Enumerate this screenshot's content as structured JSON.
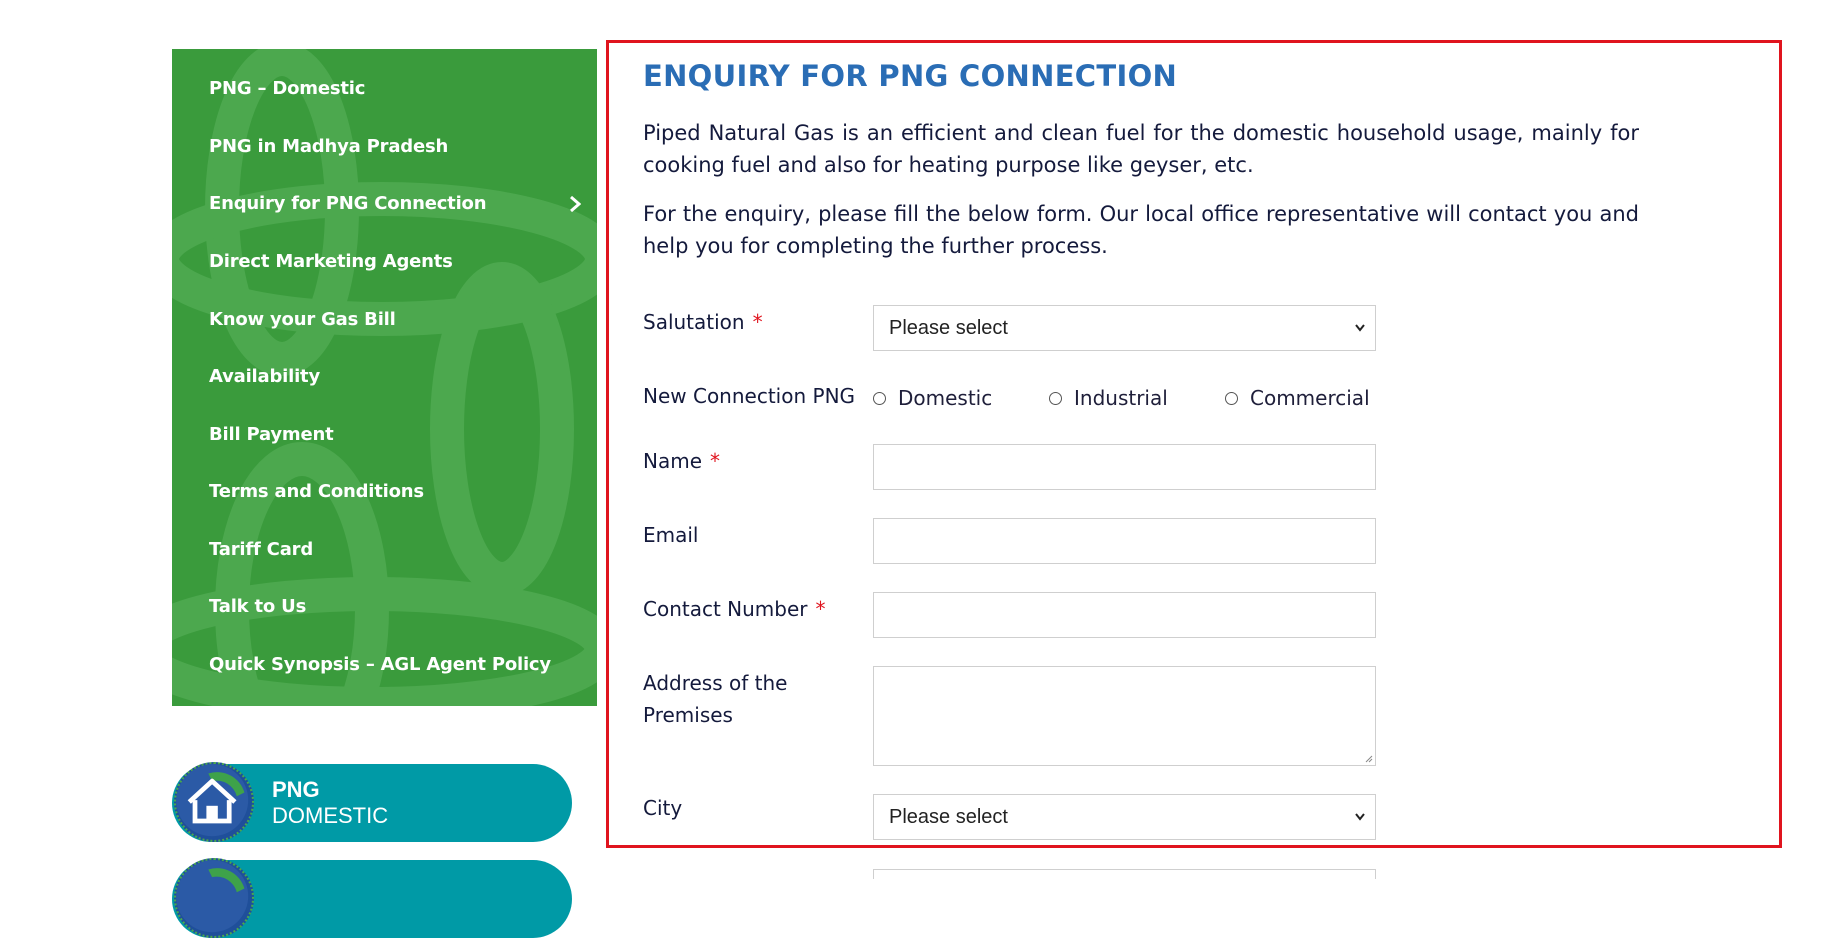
{
  "sidebar": {
    "items": [
      {
        "label": "PNG – Domestic"
      },
      {
        "label": "PNG in Madhya Pradesh"
      },
      {
        "label": "Enquiry for PNG Connection"
      },
      {
        "label": "Direct Marketing Agents"
      },
      {
        "label": "Know your Gas Bill"
      },
      {
        "label": "Availability"
      },
      {
        "label": "Bill Payment"
      },
      {
        "label": "Terms and Conditions"
      },
      {
        "label": "Tariff Card"
      },
      {
        "label": "Talk to Us"
      },
      {
        "label": "Quick Synopsis – AGL Agent Policy"
      }
    ],
    "active_index": 2
  },
  "promo": {
    "title": "PNG",
    "subtitle": "DOMESTIC"
  },
  "main": {
    "title": "ENQUIRY FOR PNG CONNECTION",
    "intro": "Piped Natural Gas is an efficient and clean fuel for the domestic household usage, mainly for cooking fuel and also for heating purpose like geyser, etc.",
    "instruction": "For the enquiry, please fill the below form. Our local office representative will contact you and help you for completing the further process."
  },
  "form": {
    "salutation_label": "Salutation",
    "salutation_value": "Please select",
    "connection_label": "New Connection PNG",
    "connection_options": [
      "Domestic",
      "Industrial",
      "Commercial"
    ],
    "name_label": "Name",
    "email_label": "Email",
    "contact_label": "Contact Number",
    "address_label": "Address of the Premises",
    "city_label": "City",
    "city_value": "Please select",
    "required_mark": "*"
  },
  "colors": {
    "sidebar_bg": "#3a9b3c",
    "title": "#2a6db5",
    "border": "#e0141e",
    "promo": "#009aa6"
  }
}
